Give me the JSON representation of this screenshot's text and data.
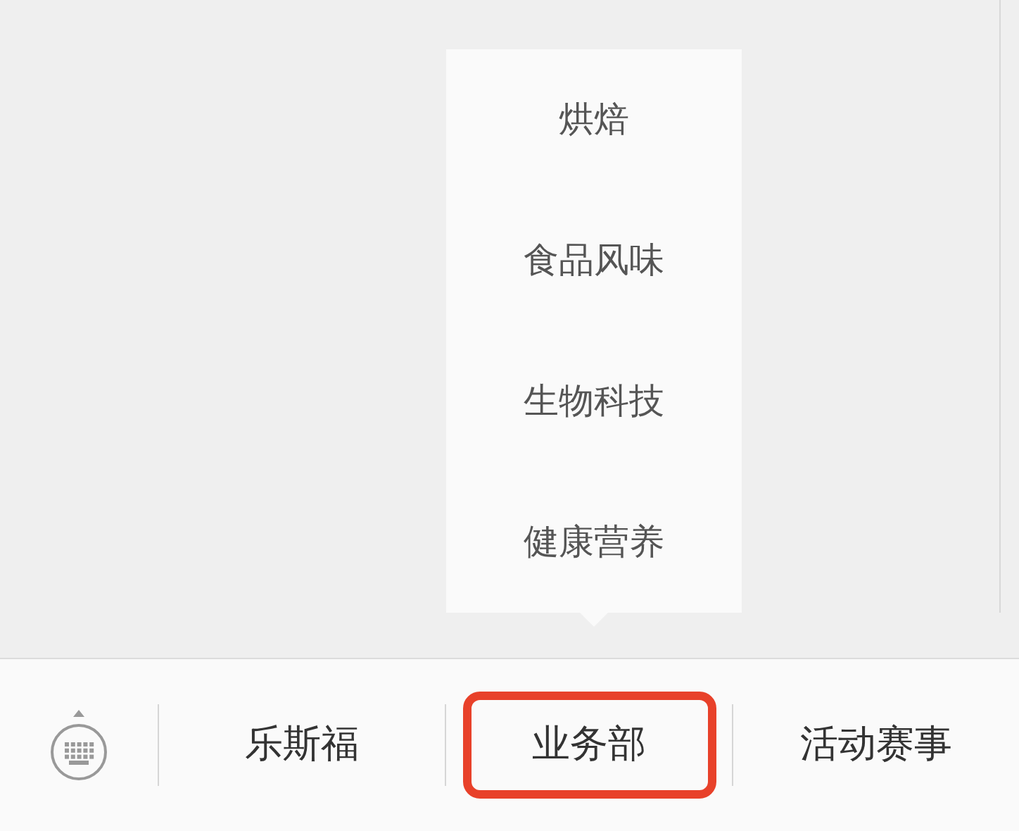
{
  "menu_items": [
    {
      "label": "乐斯福",
      "highlighted": false
    },
    {
      "label": "业务部",
      "highlighted": true,
      "expanded": true,
      "submenu": [
        "烘焙",
        "食品风味",
        "生物科技",
        "健康营养"
      ]
    },
    {
      "label": "活动赛事",
      "highlighted": false
    }
  ]
}
